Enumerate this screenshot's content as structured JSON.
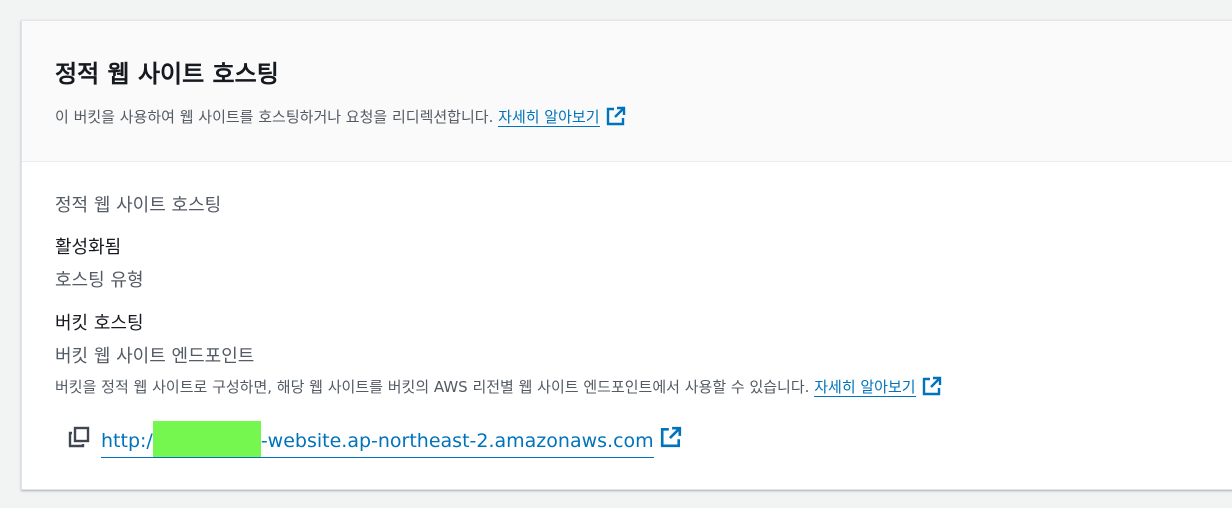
{
  "header": {
    "title": "정적 웹 사이트 호스팅",
    "description": "이 버킷을 사용하여 웹 사이트를 호스팅하거나 요청을 리디렉션합니다.",
    "learn_more": "자세히 알아보기"
  },
  "body": {
    "section_label": "정적 웹 사이트 호스팅",
    "status_value": "활성화됨",
    "hosting_type_label": "호스팅 유형",
    "hosting_type_value": "버킷 호스팅",
    "endpoint_label": "버킷 웹 사이트 엔드포인트",
    "endpoint_description": "버킷을 정적 웹 사이트로 구성하면, 해당 웹 사이트를 버킷의 AWS 리전별 웹 사이트 엔드포인트에서 사용할 수 있습니다.",
    "learn_more": "자세히 알아보기",
    "endpoint_url_prefix": "http:/",
    "endpoint_url_suffix": "-website.ap-northeast-2.amazonaws.com"
  },
  "colors": {
    "link": "#0073bb",
    "redaction": "#76f74f"
  },
  "icons": {
    "external": "external-link-icon",
    "copy": "copy-icon"
  }
}
